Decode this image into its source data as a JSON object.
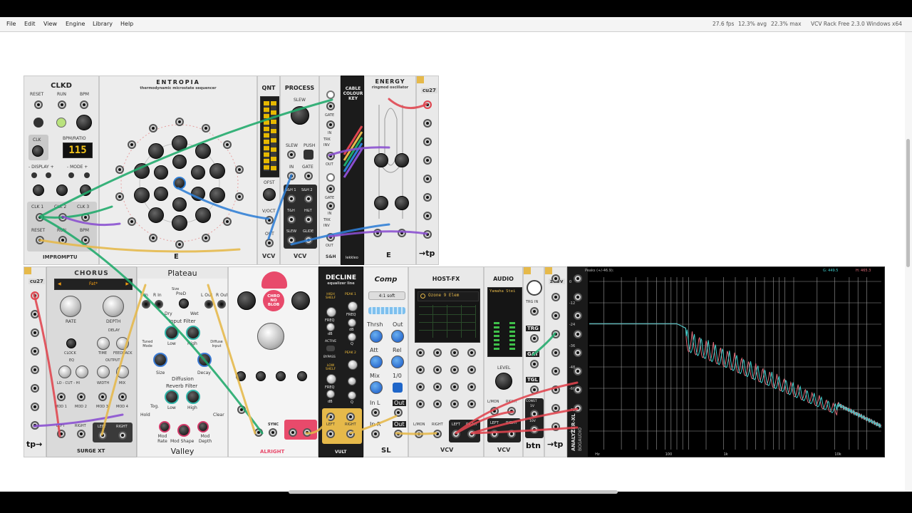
{
  "menu": {
    "file": "File",
    "edit": "Edit",
    "view": "View",
    "engine": "Engine",
    "library": "Library",
    "help": "Help"
  },
  "status": {
    "fps": "27.6 fps",
    "cpu_avg": "12.3% avg",
    "cpu_max": "22.3% max",
    "app": "VCV Rack Free 2.3.0 Windows x64"
  },
  "modules": {
    "clkd": {
      "title": "CLKD",
      "reset": "RESET",
      "run": "RUN",
      "bpm": "BPM",
      "clk": "CLK",
      "bpm_ratio": "BPM/RATIO",
      "display": "115",
      "display_label": "- DISPLAY +",
      "mode_label": "- MODE +",
      "clk1": "CLK 1",
      "clk2": "CLK 2",
      "clk3": "CLK 3",
      "out_reset": "RESET",
      "out_run": "RUN",
      "out_bpm": "BPM",
      "brand": "IMPROMPTU"
    },
    "entropia": {
      "title": "ENTROPIA",
      "subtitle": "thermodynamic microstate sequencer"
    },
    "qnt": {
      "title": "QNT",
      "ofst": "OFST",
      "voct": "V/OCT",
      "out": "OUT",
      "brand": "VCV"
    },
    "process": {
      "title": "PROCESS",
      "slew": "SLEW",
      "slew_small": "SLEW",
      "push": "PUSH",
      "in": "IN",
      "gate": "GATE",
      "sh1": "S&H 1",
      "sh2": "S&H 2",
      "th": "T&H",
      "ht": "H&T",
      "slew_out": "SLEW",
      "glide": "GLIDE",
      "brand": "VCV"
    },
    "sh": {
      "gate": "GATE",
      "in": "IN",
      "trk": "TRK",
      "inv": "INV",
      "out": "OUT",
      "gate2": "GATE",
      "in2": "IN",
      "trk2": "TRK",
      "inv2": "INV",
      "out2": "OUT",
      "label": "S&H"
    },
    "cable_key": {
      "title": "CABLE COLOUR KEY",
      "brand": "lekkleo"
    },
    "energy": {
      "title": "ENERGY",
      "subtitle": "ringmod oscillator"
    },
    "cu27_top": {
      "title": "cu27",
      "brand": "→tp"
    },
    "cu27_bottom": {
      "title": "cu27",
      "brand": "tp→"
    },
    "chorus": {
      "title": "CHORUS",
      "preset": "Fat*",
      "rate": "RATE",
      "depth": "DEPTH",
      "delay": "DELAY",
      "clock": "CLOCK",
      "time": "TIME",
      "feedback": "FEEDBACK",
      "eq": "EQ",
      "output": "OUTPUT",
      "lo_cut_hi": "LO - CUT - HI",
      "width": "WIDTH",
      "mix": "MIX",
      "mod1": "MOD 1",
      "mod2": "MOD 2",
      "mod3": "MOD 3",
      "mod4": "MOD 4",
      "left": "LEFT",
      "right": "RIGHT",
      "left_out": "LEFT",
      "right_out": "RIGHT",
      "brand": "SURGE XT"
    },
    "plateau": {
      "title": "Plateau",
      "l_in": "L In",
      "r_in": "R In",
      "size_top": "Size",
      "pre_d": "PreD",
      "l_out": "L Out",
      "r_out": "R Out",
      "dry": "Dry",
      "wet": "Wet",
      "input_filter": "Input Filter",
      "low": "Low",
      "high": "High",
      "tuned_mode": "Tuned Mode",
      "diffuse_input": "Diffuse Input",
      "size": "Size",
      "decay": "Decay",
      "diffusion": "Diffusion",
      "reverb_filter": "Reverb Filter",
      "tog": "Tog.",
      "low2": "Low",
      "high2": "High",
      "hold": "Hold",
      "clear": "Clear",
      "mod_rate": "Mod Rate",
      "mod_shape": "Mod Shape",
      "mod_depth": "Mod Depth",
      "brand": "Valley"
    },
    "chrono": {
      "title": "CHRO NO BLOB",
      "sync": "SYNC",
      "brand": "ALRIGHT"
    },
    "decline": {
      "title": "DECLINE",
      "subtitle": "equalizer line",
      "high_shelf": "HIGH SHELF",
      "peak1": "PEAK 1",
      "freq": "FREQ",
      "db": "dB",
      "q": "Q",
      "active": "ACTIVE",
      "bypass": "BYPASS",
      "peak2": "PEAK 2",
      "low_shelf": "LOW SHELF",
      "left": "LEFT",
      "right": "RIGHT",
      "brand": "VULT"
    },
    "comp": {
      "title": "Comp",
      "ratio": "4:1 soft",
      "thrsh": "Thrsh",
      "out": "Out",
      "att": "Att",
      "rel": "Rel",
      "mix": "Mix",
      "ratio_knob": "1/0",
      "in_l": "In L",
      "out_l": "Out",
      "in_r": "In R",
      "out_r": "Out",
      "brand": "SL"
    },
    "hostfx": {
      "title": "HOST-FX",
      "plugin": "Ozone 9 Elem",
      "l_mon": "L/MON",
      "right": "RIGHT",
      "left_out": "LEFT",
      "right_out": "RIGHT",
      "brand": "VCV"
    },
    "audio": {
      "title": "AUDIO",
      "device": "Yamaha Stei",
      "level": "LEVEL",
      "l_mon": "L/MON",
      "right": "RIGHT",
      "left_out": "LEFT",
      "right_out": "RIGHT",
      "brand": "VCV"
    },
    "btn": {
      "trg_in": "TRG IN",
      "trg": "TRG",
      "gat": "GAT",
      "tgl": "TGL",
      "const": "CONST",
      "v1": "1V",
      "v10": "10V",
      "brand": "btn"
    },
    "zu3v": {
      "title": "zu3v",
      "brand": "→tp"
    },
    "analyzer": {
      "peaks": "Peaks (+/-46.9):",
      "g_val": "G: 449.5",
      "h_val": "H: 465.3",
      "y_ticks": [
        "0",
        "-12",
        "-24",
        "-36",
        "-48",
        "-60",
        "-72",
        "-84"
      ],
      "x_ticks": [
        "Hz",
        "100",
        "1k",
        "10k"
      ],
      "side_label": "ANALYZER-XL",
      "side_brand": "BOGAUDIO"
    }
  },
  "colors": {
    "cable_green": "#1faa6b",
    "cable_purple": "#8a4fd1",
    "cable_blue": "#2f7fd6",
    "cable_red": "#e0454f",
    "cable_yellow": "#e6b94a",
    "analyzer_cyan": "#3fd1cf",
    "analyzer_red": "#e06b78"
  }
}
